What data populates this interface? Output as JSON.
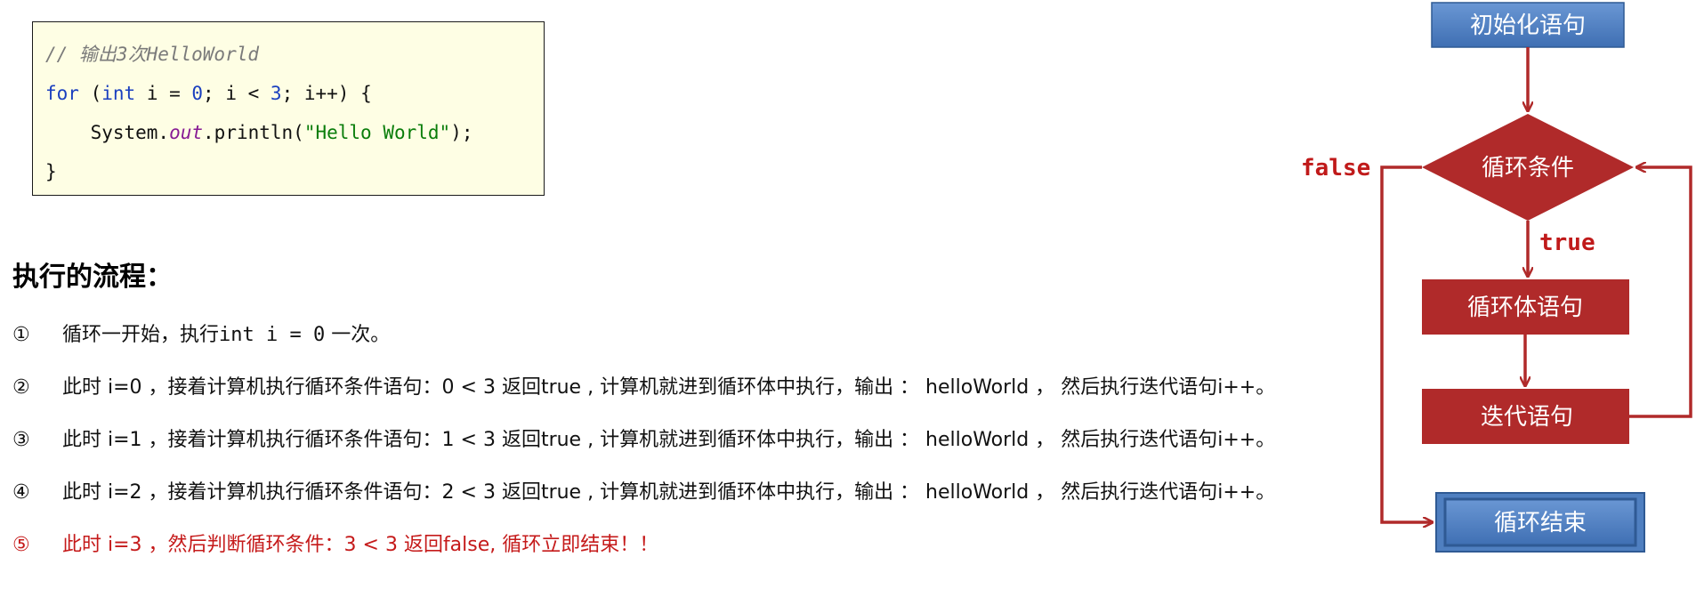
{
  "code": {
    "comment": "// 输出3次HelloWorld",
    "for_kw": "for",
    "open_paren": " (",
    "int_kw": "int",
    "init_mid": " i = ",
    "init_val": "0",
    "cond_mid": "; i < ",
    "cond_val": "3",
    "tail": "; i++) {",
    "indent": "    ",
    "sys": "System.",
    "out": "out",
    "println": ".println(",
    "str": "\"Hello World\"",
    "stmt_end": ");",
    "close": "}"
  },
  "flow_title": "执行的流程：",
  "steps": [
    {
      "num": "①",
      "pre": "循环一开始，执行",
      "code": "int i = 0",
      "post": " 一次。"
    },
    {
      "num": "②",
      "text": "此时  i=0 ，接着计算机执行循环条件语句：0 < 3 返回true , 计算机就进到循环体中执行，输出 ： helloWorld ， 然后执行迭代语句i++。"
    },
    {
      "num": "③",
      "text": "此时  i=1 ，接着计算机执行循环条件语句：1 < 3 返回true , 计算机就进到循环体中执行，输出 ： helloWorld ， 然后执行迭代语句i++。"
    },
    {
      "num": "④",
      "text": "此时  i=2 ，接着计算机执行循环条件语句：2 < 3 返回true , 计算机就进到循环体中执行，输出 ： helloWorld ， 然后执行迭代语句i++。"
    },
    {
      "num": "⑤",
      "text": "此时  i=3 ，然后判断循环条件：3 < 3 返回false, 循环立即结束！！"
    }
  ],
  "flowchart": {
    "init": "初始化语句",
    "condition": "循环条件",
    "body": "循环体语句",
    "iterate": "迭代语句",
    "end": "循环结束",
    "true_label": "true",
    "false_label": "false"
  },
  "colors": {
    "red": "#b02a2a",
    "blue": "#4f7fc0",
    "code_bg": "#fefee4",
    "highlight_text": "#c51a1a"
  }
}
